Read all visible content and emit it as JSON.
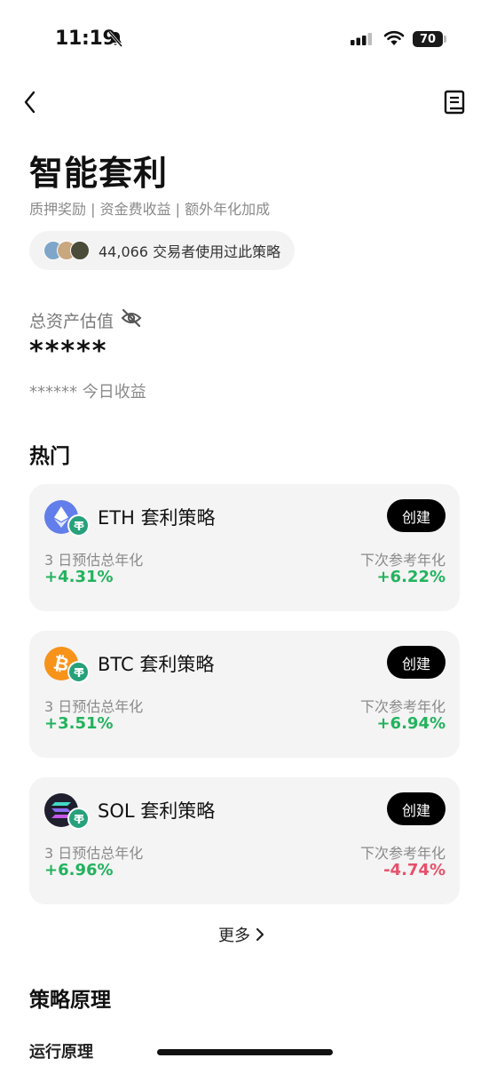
{
  "status_bar": {
    "time": "11:19",
    "battery": "70"
  },
  "page": {
    "title": "智能套利",
    "subtitle": "质押奖励 | 资金费收益 | 额外年化加成",
    "users_text": "44,066 交易者使用过此策略"
  },
  "assets": {
    "label": "总资产估值",
    "value": "*****",
    "today_earnings": "****** 今日收益"
  },
  "hot": {
    "heading": "热门",
    "cards": [
      {
        "title": "ETH 套利策略",
        "button": "创建",
        "left_label": "3 日预估总年化",
        "left_value": "+4.31%",
        "right_label": "下次参考年化",
        "right_value": "+6.22%"
      },
      {
        "title": "BTC 套利策略",
        "button": "创建",
        "left_label": "3 日预估总年化",
        "left_value": "+3.51%",
        "right_label": "下次参考年化",
        "right_value": "+6.94%"
      },
      {
        "title": "SOL 套利策略",
        "button": "创建",
        "left_label": "3 日预估总年化",
        "left_value": "+6.96%",
        "right_label": "下次参考年化",
        "right_value": "-4.74%"
      }
    ],
    "more": "更多"
  },
  "principle": {
    "heading": "策略原理",
    "run_label": "运行原理"
  },
  "colors": {
    "positive": "#22b35e",
    "negative": "#e8506a",
    "eth": "#627eea",
    "btc": "#f7931a",
    "sol": "#1f1f2e",
    "usdt": "#26a17b"
  },
  "icons": [
    "back-icon",
    "document-icon",
    "bell-off-icon",
    "eye-off-icon",
    "chevron-right-icon"
  ]
}
